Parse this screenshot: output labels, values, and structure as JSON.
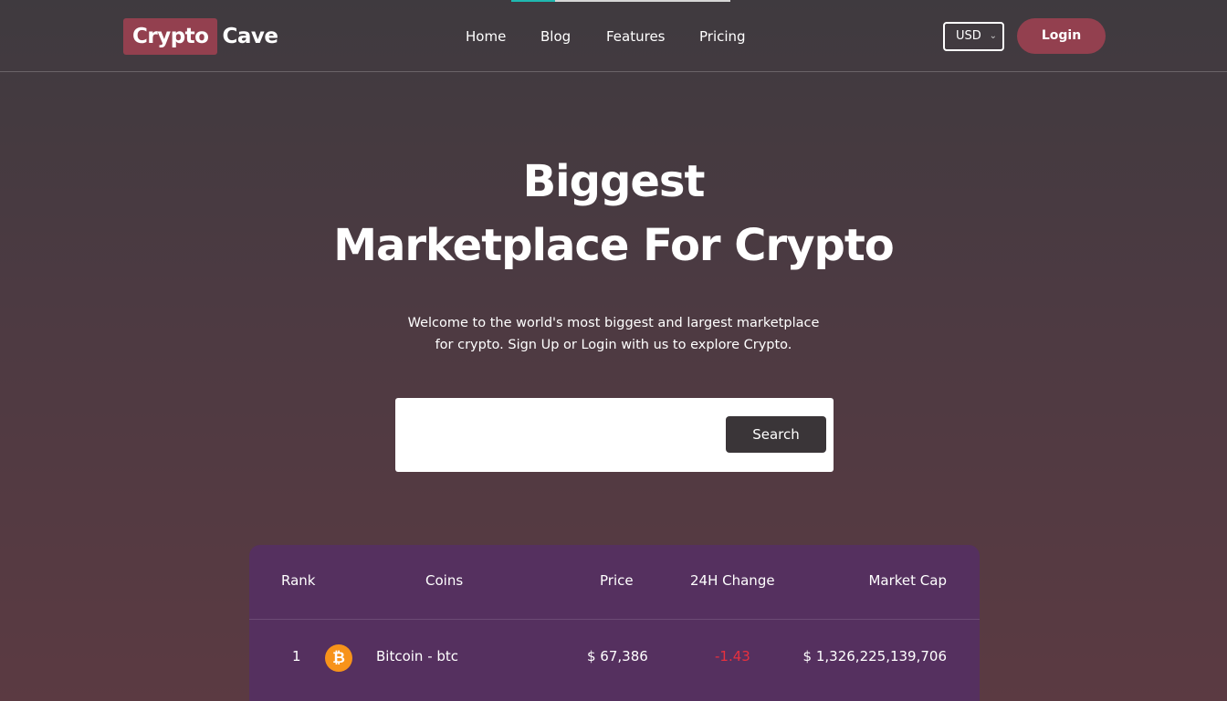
{
  "brand": {
    "logo_part1": "Crypto",
    "logo_part2": "Cave",
    "accent_color": "#93404f"
  },
  "nav": {
    "items": [
      {
        "label": "Home"
      },
      {
        "label": "Blog"
      },
      {
        "label": "Features"
      },
      {
        "label": "Pricing"
      }
    ],
    "currency": "USD",
    "login_label": "Login"
  },
  "hero": {
    "title_line1": "Biggest",
    "title_line2": "Marketplace For Crypto",
    "subtitle_line1": "Welcome to the world's most biggest and largest marketplace",
    "subtitle_line2": "for crypto. Sign Up or Login with us to explore Crypto."
  },
  "search": {
    "value": "",
    "button_label": "Search"
  },
  "table": {
    "columns": [
      "Rank",
      "Coins",
      "Price",
      "24H Change",
      "Market Cap"
    ],
    "rows": [
      {
        "rank": "1",
        "icon": "bitcoin-icon",
        "coin": "Bitcoin - btc",
        "price": "$ 67,386",
        "change": "-1.43",
        "market_cap": "$ 1,326,225,139,706"
      }
    ],
    "negative_color": "#e8303e"
  },
  "page_loading_progress": 0.2
}
